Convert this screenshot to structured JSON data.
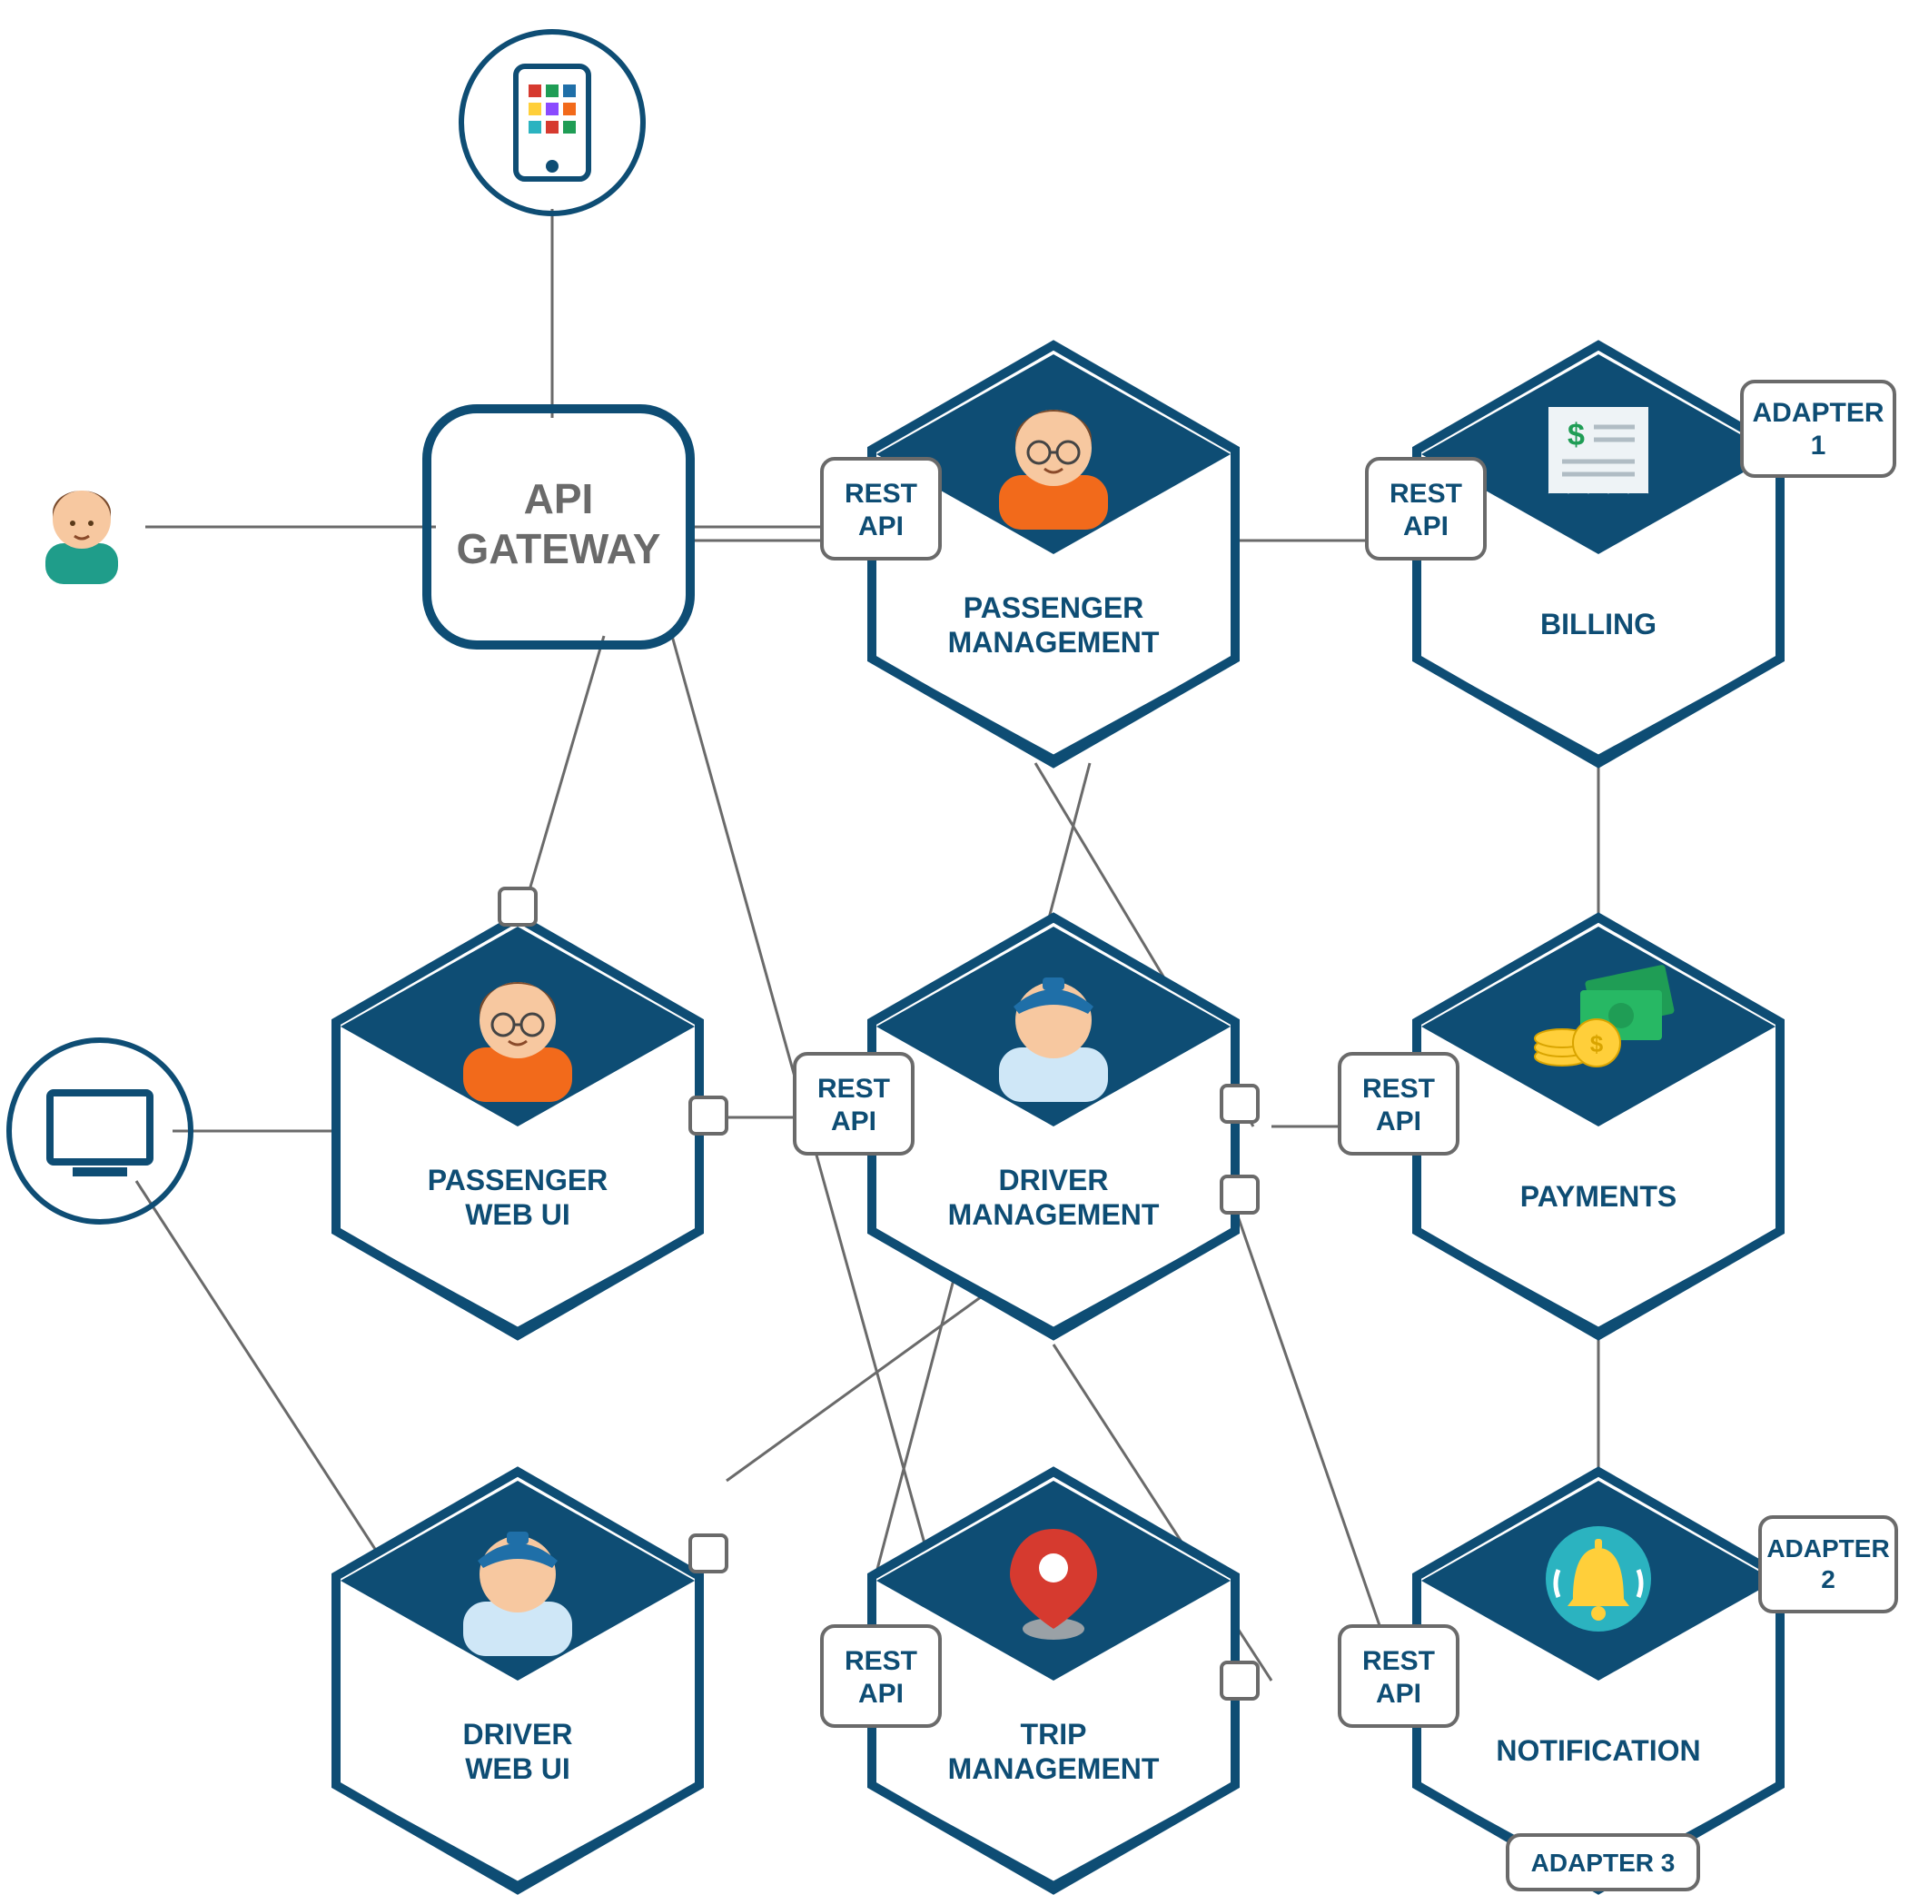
{
  "gateway": {
    "line1": "API",
    "line2": "GATEWAY"
  },
  "badges": {
    "rest": "REST",
    "api": "API",
    "adapter": "ADAPTER",
    "a1": "1",
    "a2": "2",
    "a3": "3"
  },
  "services": {
    "passenger_mgmt": {
      "line1": "PASSENGER",
      "line2": "MANAGEMENT"
    },
    "billing": {
      "line1": "BILLING"
    },
    "passenger_web": {
      "line1": "PASSENGER",
      "line2": "WEB UI"
    },
    "driver_mgmt": {
      "line1": "DRIVER",
      "line2": "MANAGEMENT"
    },
    "payments": {
      "line1": "PAYMENTS"
    },
    "driver_web": {
      "line1": "DRIVER",
      "line2": "WEB UI"
    },
    "trip_mgmt": {
      "line1": "TRIP",
      "line2": "MANAGEMENT"
    },
    "notification": {
      "line1": "NOTIFICATION"
    }
  },
  "colors": {
    "navy": "#0e4d74",
    "gray": "#6a6a6a",
    "skin": "#f7c8a0",
    "hair": "#7a4a2a",
    "orange": "#f26a1b",
    "blue": "#1f6fa8",
    "lightblue": "#cfe7f7",
    "green": "#1f9d55",
    "red": "#d63a2f",
    "yellow": "#ffcf3a",
    "teal": "#2bb3c0"
  }
}
